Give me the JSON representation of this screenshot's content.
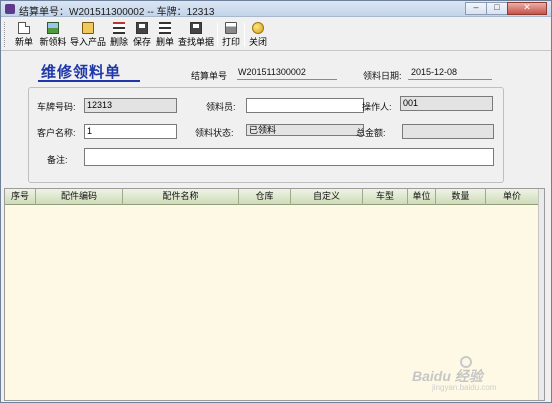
{
  "window": {
    "title": "结算单号：W201511300002 -- 车牌：12313",
    "minimize_glyph": "–",
    "maximize_glyph": "□",
    "close_glyph": "✕"
  },
  "toolbar": {
    "buttons": [
      {
        "label": "新单",
        "icon": "new-doc-icon"
      },
      {
        "label": "新领料",
        "icon": "new-material-icon"
      },
      {
        "label": "导入产品",
        "icon": "import-icon"
      },
      {
        "label": "删除",
        "icon": "delete-icon"
      },
      {
        "label": "保存",
        "icon": "save-icon"
      },
      {
        "label": "删单",
        "icon": "delete-bill-icon"
      },
      {
        "label": "查找单据",
        "icon": "find-bill-icon"
      },
      {
        "label": "打印",
        "icon": "print-icon"
      },
      {
        "label": "关闭",
        "icon": "close-key-icon"
      }
    ]
  },
  "form": {
    "title": "维修领料单",
    "settlement_no_label": "结算单号",
    "settlement_no": "W201511300002",
    "date_label": "领料日期:",
    "date": "2015-12-08",
    "plate_label": "车牌号码:",
    "plate": "12313",
    "picker_label": "领料员:",
    "picker": "",
    "operator_label": "操作人:",
    "operator": "001",
    "customer_label": "客户名称:",
    "customer": "1",
    "status_label": "领料状态:",
    "status": "已领料",
    "total_label": "总金额:",
    "total": "",
    "remark_label": "备注:",
    "remark": ""
  },
  "grid": {
    "columns": [
      "序号",
      "配件编码",
      "配件名称",
      "仓库",
      "自定义",
      "车型",
      "单位",
      "数量",
      "单价"
    ]
  },
  "watermark": {
    "text": "Baidu 经验",
    "sub": "jingyan.baidu.com"
  }
}
